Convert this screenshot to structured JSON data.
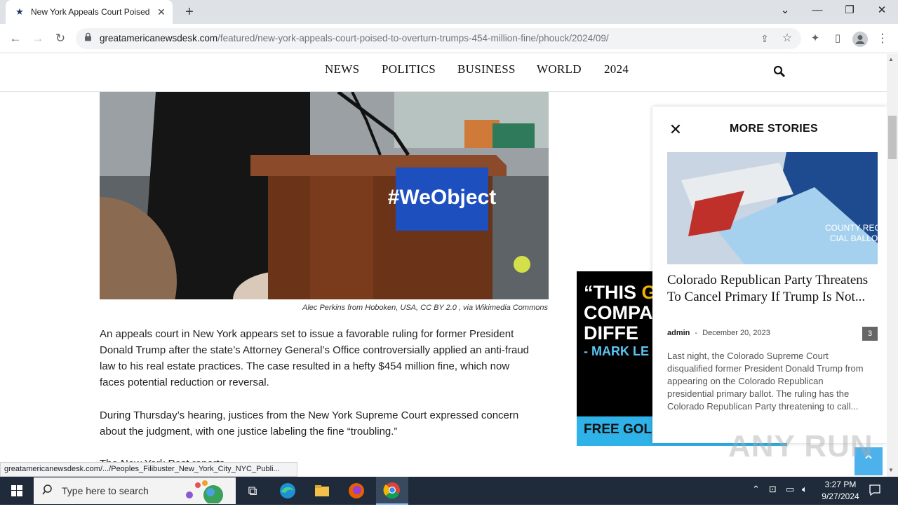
{
  "browser": {
    "tab_title": "New York Appeals Court Poised",
    "url_host": "greatamericanewsdesk.com",
    "url_path": "/featured/new-york-appeals-court-poised-to-overturn-trumps-454-million-fine/phouck/2024/09/"
  },
  "nav": {
    "items": [
      "NEWS",
      "POLITICS",
      "BUSINESS",
      "WORLD",
      "2024"
    ]
  },
  "article": {
    "image_alt": "#WeObject",
    "caption": "Alec Perkins from Hoboken, USA, CC BY 2.0 , via Wikimedia Commons",
    "paragraphs": [
      "An appeals court in New York appears set to issue a favorable ruling for former President Donald Trump after the state’s Attorney General’s Office controversially applied an anti-fraud law to his real estate practices. The case resulted in a hefty $454 million fine, which now faces potential reduction or reversal.",
      "During Thursday’s hearing, justices from the New York Supreme Court expressed concern about the judgment, with one justice labeling the fine “troubling.”",
      "The New York Post reports"
    ]
  },
  "ad": {
    "line1_a": "“THIS ",
    "line1_b": "GO",
    "line2": "COMPA",
    "line3": "DIFFE",
    "attribution": "- MARK LE",
    "footer": "FREE GOLD"
  },
  "more_stories": {
    "heading": "MORE STORIES",
    "story": {
      "title": "Colorado Republican Party Threatens To Cancel Primary If Trump Is Not...",
      "author": "admin",
      "separator": "-",
      "date": "December 20, 2023",
      "comment_count": "3",
      "excerpt": "Last night, the Colorado Supreme Court disqualified former President Donald Trump from appearing on the Colorado Republican presidential primary ballot. The ruling has the Colorado Republican Party threatening to call..."
    }
  },
  "status_bar": "greatamericanewsdesk.com/.../Peoples_Filibuster_New_York_City_NYC_Publi...",
  "watermark": "ANY RUN",
  "taskbar": {
    "search_placeholder": "Type here to search",
    "time": "3:27 PM",
    "date": "9/27/2024"
  },
  "colors": {
    "accent": "#4db2ec",
    "taskbar": "#1f2b3a",
    "tab_strip": "#dee1e6"
  }
}
